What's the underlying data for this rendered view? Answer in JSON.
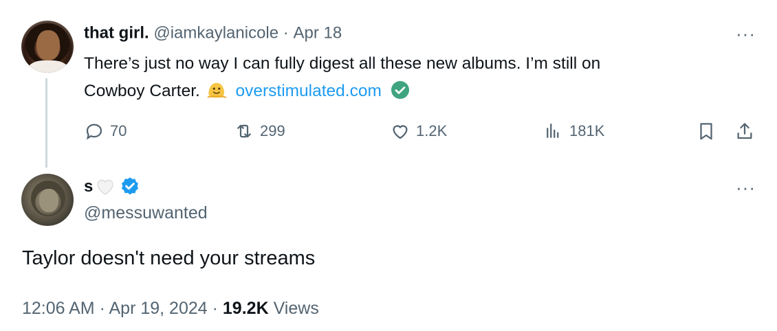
{
  "parent_tweet": {
    "display_name": "that girl.",
    "handle": "@iamkaylanicole",
    "separator": "·",
    "date": "Apr 18",
    "text_line1": "There’s just no way I can fully digest all these new albums. I’m still on",
    "text_line2_prefix": "Cowboy Carter.",
    "emoji_name": "melting-face-emoji",
    "link_text": "overstimulated.com",
    "more_label": "···",
    "actions": {
      "replies": "70",
      "reposts": "299",
      "likes": "1.2K",
      "views": "181K"
    }
  },
  "reply_tweet": {
    "display_name": "s",
    "handle": "@messuwanted",
    "more_label": "···",
    "text": "Taylor doesn't need your streams",
    "time": "12:06 AM",
    "separator": "·",
    "date": "Apr 19, 2024",
    "views_count": "19.2K",
    "views_label": "Views"
  },
  "colors": {
    "link": "#1d9bf0",
    "muted": "#536471",
    "verified": "#1d9bf0",
    "thread_line": "#cfd9de",
    "link_verified": "#3fa47f"
  }
}
